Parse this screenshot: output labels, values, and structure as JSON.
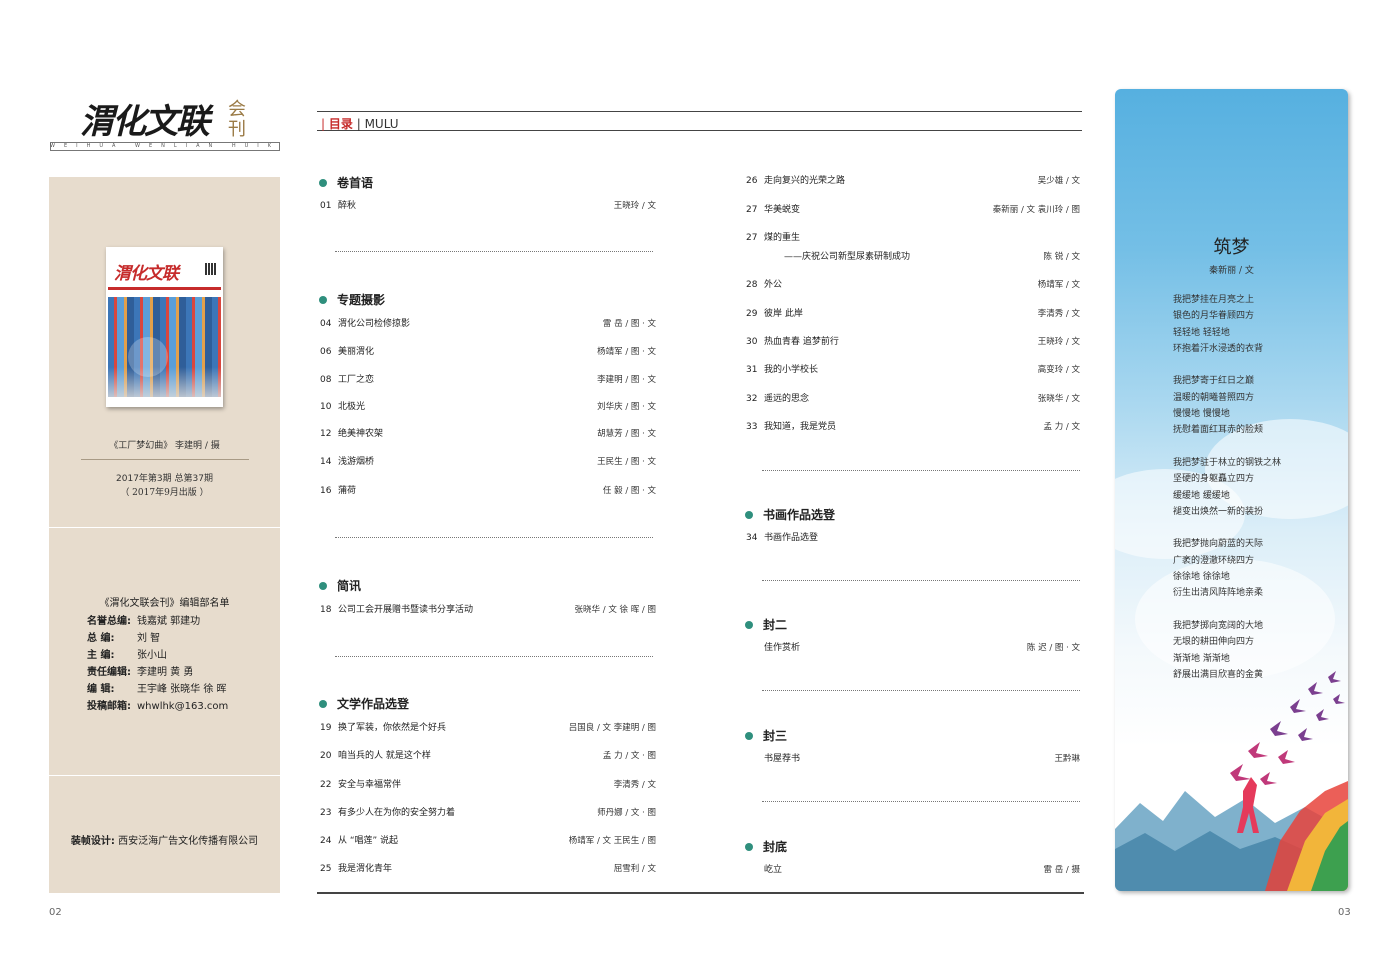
{
  "masthead": {
    "title": "渭化文联",
    "side": "会刊",
    "subtitle": "WEIHUA WENLIAN HUIKAN"
  },
  "left": {
    "cover": {
      "title": "渭化文联"
    },
    "cover_caption": "《工厂梦幻曲》 李建明 / 摄",
    "issue": "2017年第3期    总第37期",
    "issue_date": "（ 2017年9月出版 ）",
    "staff_title": "《渭化文联会刊》编辑部名单",
    "staff": [
      {
        "role": "名誉总编:",
        "names": "钱嘉斌    郭建功"
      },
      {
        "role": "总    编:",
        "names": "刘  智"
      },
      {
        "role": "主    编:",
        "names": "张小山"
      },
      {
        "role": "责任编辑:",
        "names": "李建明    黄  勇"
      },
      {
        "role": "编    辑:",
        "names": "王宇峰    张晓华    徐  晖"
      },
      {
        "role": "投稿邮箱:",
        "names": "whwlhk@163.com"
      }
    ],
    "design_label": "装帧设计:",
    "design_value": "西安泛海广告文化传播有限公司"
  },
  "toc_header": {
    "cn": "目录",
    "en": "MULU"
  },
  "sections": {
    "juanshouyu": {
      "title": "卷首语",
      "entries": [
        {
          "page": "01",
          "title": "醉秋",
          "author": "王晓玲  /  文"
        }
      ]
    },
    "zhuanti": {
      "title": "专题摄影",
      "entries": [
        {
          "page": "04",
          "title": "渭化公司检修掠影",
          "author": "雷  岳  /  图 · 文"
        },
        {
          "page": "06",
          "title": "美丽渭化",
          "author": "杨靖军  /  图 · 文"
        },
        {
          "page": "08",
          "title": "工厂之恋",
          "author": "李建明  /  图 · 文"
        },
        {
          "page": "10",
          "title": "北极光",
          "author": "刘华庆  /  图 · 文"
        },
        {
          "page": "12",
          "title": "绝美神农架",
          "author": "胡慧芳  /  图 · 文"
        },
        {
          "page": "14",
          "title": "浅游烟桥",
          "author": "王民生  /  图 · 文"
        },
        {
          "page": "16",
          "title": "蒲荷",
          "author": "任  毅  /  图 · 文"
        }
      ]
    },
    "jianxun": {
      "title": "简讯",
      "entries": [
        {
          "page": "18",
          "title": "公司工会开展赠书暨读书分享活动",
          "author": "张晓华  /  文      徐  晖  /  图"
        }
      ]
    },
    "wenxue": {
      "title": "文学作品选登",
      "entries": [
        {
          "page": "19",
          "title": "换了军装，你依然是个好兵",
          "author": "吕国良  /  文      李建明  /  图"
        },
        {
          "page": "20",
          "title": "咱当兵的人 就是这个样",
          "author": "孟  力  /  文 · 图"
        },
        {
          "page": "22",
          "title": "安全与幸福常伴",
          "author": "李清秀  /  文"
        },
        {
          "page": "23",
          "title": "有多少人在为你的安全努力着",
          "author": "师丹娜  /  文 · 图"
        },
        {
          "page": "24",
          "title": "从 “唱莲” 说起",
          "author": "杨靖军  /  文      王民生  /  图"
        },
        {
          "page": "25",
          "title": "我是渭化青年",
          "author": "屈雪利  /  文"
        }
      ]
    },
    "continued": {
      "entries": [
        {
          "page": "26",
          "title": "走向复兴的光荣之路",
          "author": "吴少雄  /  文"
        },
        {
          "page": "27",
          "title": "华美蜕变",
          "author": "秦新丽  /  文      袁川玲  /  图"
        },
        {
          "page": "27",
          "title": "煤的重生",
          "subtitle": "——庆祝公司新型尿素研制成功",
          "author": "陈  锐  /  文"
        },
        {
          "page": "28",
          "title": "外公",
          "author": "杨靖军  /  文"
        },
        {
          "page": "29",
          "title": "彼岸   此岸",
          "author": "李清秀  /  文"
        },
        {
          "page": "30",
          "title": "热血青春  追梦前行",
          "author": "王晓玲  /  文"
        },
        {
          "page": "31",
          "title": "我的小学校长",
          "author": "高变玲  /  文"
        },
        {
          "page": "32",
          "title": "遥远的思念",
          "author": "张晓华  /  文"
        },
        {
          "page": "33",
          "title": "我知道，我是党员",
          "author": "孟  力  /  文"
        }
      ]
    },
    "shuhua": {
      "title": "书画作品选登",
      "entries": [
        {
          "page": "34",
          "title": "书画作品选登",
          "author": ""
        }
      ]
    },
    "fenger": {
      "title": "封二",
      "entries": [
        {
          "page": "",
          "title": "佳作赏析",
          "author": "陈  迟  /  图 · 文"
        }
      ]
    },
    "fengsan": {
      "title": "封三",
      "entries": [
        {
          "page": "",
          "title": "书屋荐书",
          "author": "王黔琳"
        }
      ]
    },
    "fengdi": {
      "title": "封底",
      "entries": [
        {
          "page": "",
          "title": "屹立",
          "author": "雷  岳  /  摄"
        }
      ]
    }
  },
  "poem": {
    "title": "筑梦",
    "author": "秦新丽 / 文",
    "stanzas": [
      [
        "我把梦挂在月亮之上",
        "银色的月华眷顾四方",
        "轻轻地   轻轻地",
        "环抱着汗水浸透的衣背"
      ],
      [
        "我把梦寄于红日之巅",
        "温暖的朝曦普照四方",
        "慢慢地   慢慢地",
        "抚慰着面红耳赤的脸颊"
      ],
      [
        "我把梦驻于林立的钢铁之林",
        "坚硬的身躯矗立四方",
        "缓缓地   缓缓地",
        "褪变出焕然一新的装扮"
      ],
      [
        "我把梦抛向蔚蓝的天际",
        "广袤的澄澈环绕四方",
        "徐徐地   徐徐地",
        "衍生出清风阵阵地亲柔"
      ],
      [
        "我把梦掷向宽阔的大地",
        "无垠的耕田伸向四方",
        "渐渐地   渐渐地",
        "舒展出满目欣喜的金黄"
      ]
    ]
  },
  "page_numbers": {
    "left": "02",
    "right": "03"
  },
  "colors": {
    "accent_red": "#c62b2b",
    "dot_green": "#2f8f7d",
    "panel_beige": "#e7dccd",
    "sky_blue": "#56b0e0"
  }
}
